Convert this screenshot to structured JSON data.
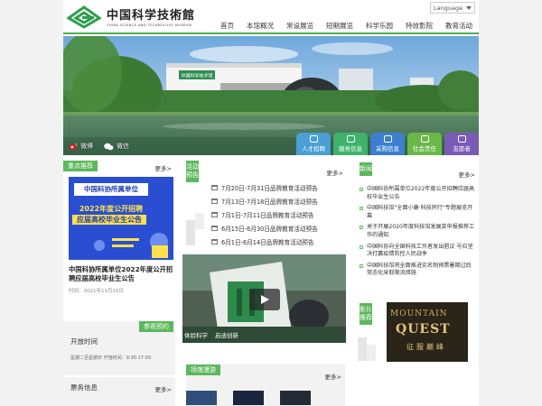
{
  "header": {
    "logo_cn": "中国科学技術館",
    "logo_en": "CHINA SCIENCE AND TECHNOLOGY MUSEUM",
    "language": "Language",
    "nav": [
      "首页",
      "本馆概况",
      "常设展览",
      "短期展览",
      "科学乐园",
      "特效影院",
      "教育活动"
    ]
  },
  "banner": {
    "building_sign": "中国科学技术馆",
    "social": [
      {
        "icon": "weibo-icon",
        "label": "微博"
      },
      {
        "icon": "wechat-icon",
        "label": "微信"
      }
    ],
    "quick_links": [
      {
        "label": "人才招聘",
        "color": "#4a9fd6"
      },
      {
        "label": "服务信息",
        "color": "#3db36b"
      },
      {
        "label": "采购信息",
        "color": "#3d7fcf"
      },
      {
        "label": "社会责任",
        "color": "#6bb84a"
      },
      {
        "label": "志愿者",
        "color": "#7a5bb5"
      }
    ]
  },
  "featured": {
    "tag": "重点推荐",
    "more": "更多>",
    "poster_line1": "中国科协所属单位",
    "poster_line2": "2022年度公开招聘",
    "poster_line3": "应届高校毕业生公告",
    "title": "中国科协所属单位2022年度公开招聘应届高校毕业生公告",
    "time": "时间：2021年11月15日"
  },
  "visit": {
    "tag": "参观预约",
    "open_title": "开放时间",
    "open_text": "星期二至星期日 开馆时间：9:30-17:00",
    "ticket_title": "票务信息",
    "more": "更多>"
  },
  "activities": {
    "tag": "活动预告",
    "more": "更多>",
    "items": [
      "7月20日-7月31日品牌教育活动预告",
      "7月13日-7月18日品牌教育活动预告",
      "7月1日-7月11日品牌教育活动预告",
      "6月15日-6月30日品牌教育活动预告",
      "6月1日-6月14日品牌教育活动预告"
    ],
    "video_caption": [
      "体验科学",
      "启迪创新"
    ]
  },
  "venue": {
    "tag": "场馆漫游",
    "more": "更多>"
  },
  "news": {
    "tag": "新闻",
    "more": "更多>",
    "items": [
      "中国科协所属单位2022年度公开招聘应届高校毕业生公告",
      "中国科技馆\"全面小康·科技同行\"专题展览开幕",
      "关于开展2020年度科技馆发展奖申报推荐工作的通知",
      "中国科协向全国科技工作者发出倡议 号召坚决打赢疫情防控人民战争",
      "中国科技馆将全面推进实名制预票暑期过后常态化采取限流措施"
    ]
  },
  "film": {
    "tag": "影片推荐",
    "line1": "MOUNTAIN",
    "line2": "QUEST",
    "line3": "征服巅峰"
  }
}
